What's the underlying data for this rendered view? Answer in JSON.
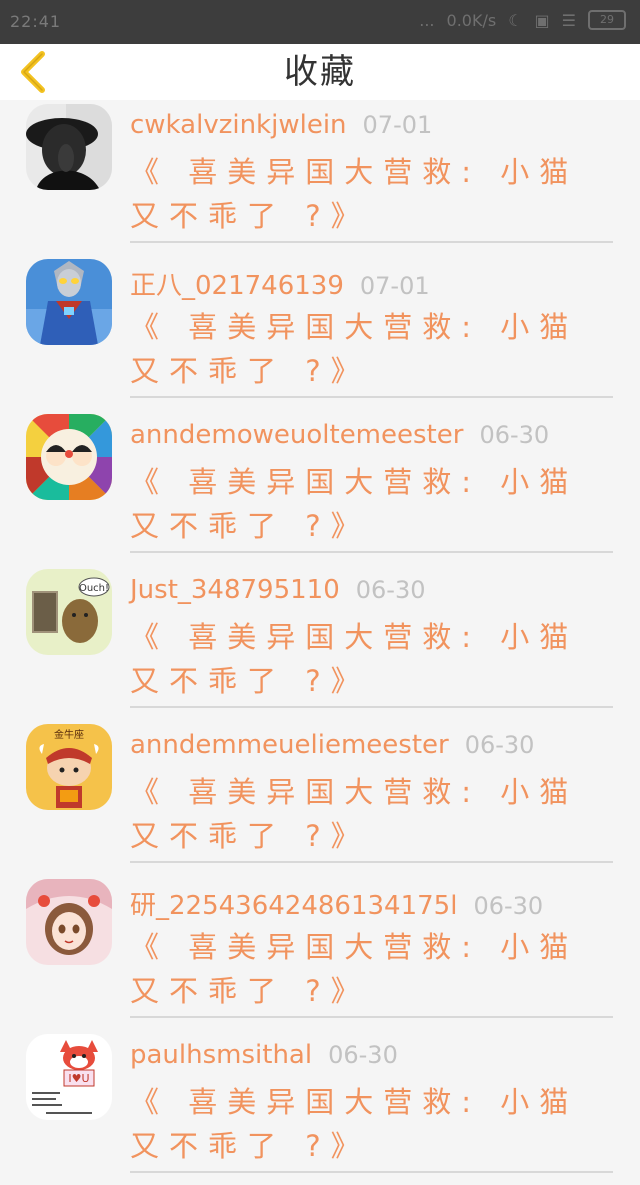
{
  "status_bar": {
    "time": "22:41",
    "signal": "...",
    "network_speed": "0.0K/s",
    "battery": "29"
  },
  "header": {
    "title": "收藏"
  },
  "favorites": [
    {
      "username": "cwkalvzinkjwlein",
      "date": "07-01",
      "title": "《 喜美异国大营救: 小猫又不乖了 ?》",
      "avatar": "man-in-hat"
    },
    {
      "username": "正八_021746139",
      "date": "07-01",
      "title": "《 喜美异国大营救: 小猫又不乖了 ?》",
      "avatar": "ultraman"
    },
    {
      "username": "anndemoweuoltemeester",
      "date": "06-30",
      "title": "《 喜美异国大营救: 小猫又不乖了 ?》",
      "avatar": "cartoon-kids"
    },
    {
      "username": "Just_348795110",
      "date": "06-30",
      "title": "《 喜美异国大营救: 小猫又不乖了 ?》",
      "avatar": "ouch-cartoon"
    },
    {
      "username": "anndemmeueliemeester",
      "date": "06-30",
      "title": "《 喜美异国大营救: 小猫又不乖了 ?》",
      "avatar": "taurus-cartoon"
    },
    {
      "username": "研_22543642486134175l",
      "date": "06-30",
      "title": "《 喜美异国大营救: 小猫又不乖了 ?》",
      "avatar": "anime-girl"
    },
    {
      "username": "paulhsmsithal",
      "date": "06-30",
      "title": "《 喜美异国大营救: 小猫又不乖了 ?》",
      "avatar": "fox-i-love-you"
    }
  ],
  "avatar_texts": {
    "ouch": "Ouch!",
    "taurus": "金牛座",
    "iou": "I♥U"
  },
  "colors": {
    "accent": "#f1935e",
    "date": "#c2c2c2",
    "back_arrow": "#f3c21f",
    "status_bar": "#3d3d3d"
  }
}
